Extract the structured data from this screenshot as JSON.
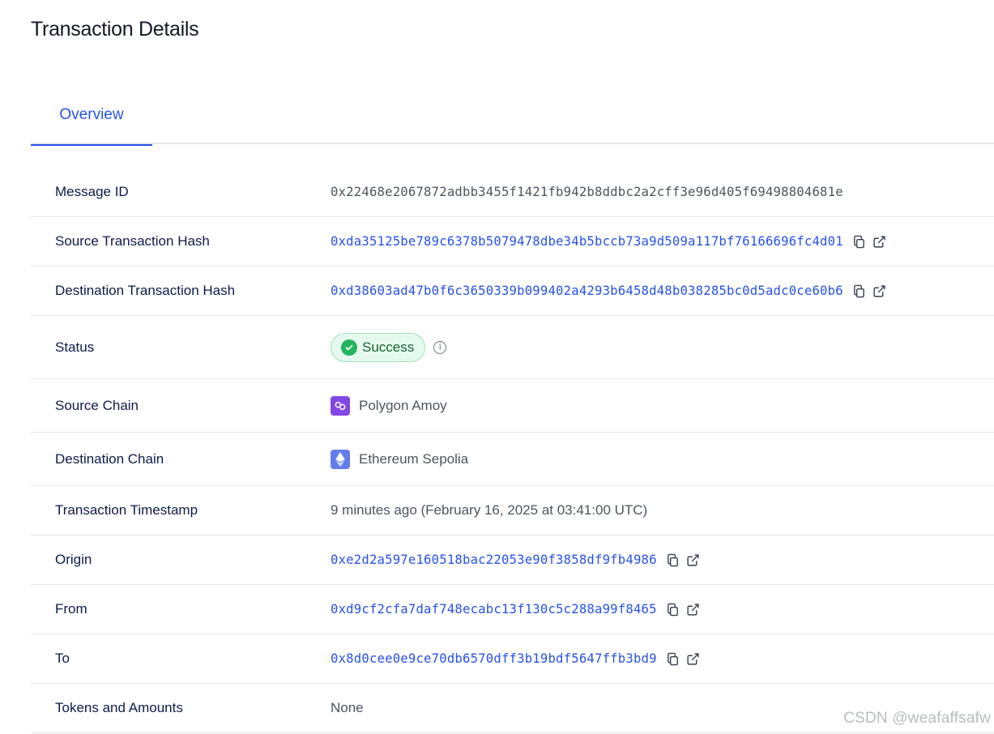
{
  "page": {
    "title": "Transaction Details"
  },
  "tabs": [
    {
      "label": "Overview"
    }
  ],
  "rows": {
    "message_id": {
      "label": "Message ID",
      "value": "0x22468e2067872adbb3455f1421fb942b8ddbc2a2cff3e96d405f69498804681e"
    },
    "source_tx": {
      "label": "Source Transaction Hash",
      "value": "0xda35125be789c6378b5079478dbe34b5bccb73a9d509a117bf76166696fc4d01"
    },
    "dest_tx": {
      "label": "Destination Transaction Hash",
      "value": "0xd38603ad47b0f6c3650339b099402a4293b6458d48b038285bc0d5adc0ce60b6"
    },
    "status": {
      "label": "Status",
      "value": "Success"
    },
    "source_chain": {
      "label": "Source Chain",
      "value": "Polygon Amoy"
    },
    "dest_chain": {
      "label": "Destination Chain",
      "value": "Ethereum Sepolia"
    },
    "timestamp": {
      "label": "Transaction Timestamp",
      "value": "9 minutes ago (February 16, 2025 at 03:41:00 UTC)"
    },
    "origin": {
      "label": "Origin",
      "value": "0xe2d2a597e160518bac22053e90f3858df9fb4986"
    },
    "from": {
      "label": "From",
      "value": "0xd9cf2cfa7daf748ecabc13f130c5c288a99f8465"
    },
    "to": {
      "label": "To",
      "value": "0x8d0cee0e9ce70db6570dff3b19bdf5647ffb3bd9"
    },
    "tokens": {
      "label": "Tokens and Amounts",
      "value": "None"
    }
  },
  "icons": {
    "copy": "copy-icon",
    "external": "external-link-icon",
    "check": "check-circle-icon",
    "info": "info-icon",
    "polygon": "polygon-logo",
    "ethereum": "ethereum-logo"
  },
  "colors": {
    "accent": "#2752e7",
    "success_bg": "#e6f9ee",
    "success_border": "#9be3b4",
    "success_icon": "#22b55d",
    "polygon": "#8247e5",
    "ethereum": "#627eea"
  },
  "watermark": "CSDN @weafaffsafw"
}
